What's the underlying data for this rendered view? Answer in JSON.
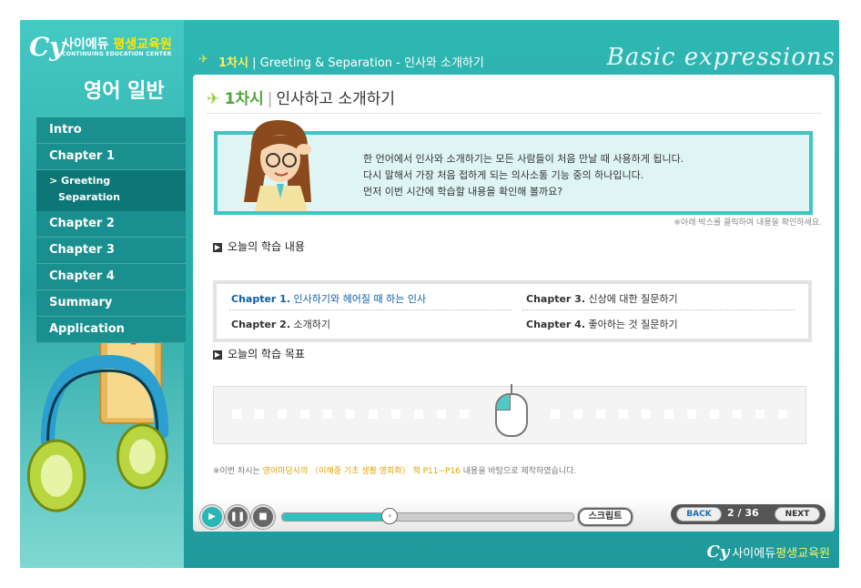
{
  "brand": {
    "logo": "Cy",
    "name_white": "사이에듀",
    "name_yellow": "평생교육원",
    "sub": "CONTINUING EDUCATION CENTER"
  },
  "course_title": "영어 일반",
  "topbar": {
    "session": "1차시",
    "breadcrumb": "Greeting & Separation - 인사와 소개하기",
    "script_title": "Basic expressions"
  },
  "nav": {
    "items": [
      "Intro",
      "Chapter 1",
      "Chapter 2",
      "Chapter 3",
      "Chapter 4",
      "Summary",
      "Application"
    ],
    "sub_items": [
      "> Greeting",
      "Separation"
    ]
  },
  "page": {
    "session": "1차시",
    "title": "인사하고 소개하기"
  },
  "speech": {
    "lines": [
      "한 언어에서 인사와 소개하기는 모든 사람들이 처음 만날 때 사용하게 됩니다.",
      "다시 말해서 가장 처음 접하게 되는 의사소통 기능 중의 하나입니다.",
      "먼저 이번 시간에 학습할 내용을 확인해 볼까요?"
    ]
  },
  "note_click": "※아래 박스를 클릭하여 내용을 확인하세요.",
  "section_contents": {
    "title": "오늘의 학습 내용"
  },
  "chapters": [
    {
      "label": "Chapter 1.",
      "text": "인사하기와 헤어질 때 하는 인사"
    },
    {
      "label": "Chapter 2.",
      "text": "소개하기"
    },
    {
      "label": "Chapter 3.",
      "text": "신상에 대한 질문하기"
    },
    {
      "label": "Chapter 4.",
      "text": "좋아하는 것 질문하기"
    }
  ],
  "section_goals": {
    "title": "오늘의 학습 목표"
  },
  "note_source": {
    "prefix": "※이번 차시는 ",
    "highlight": "영어마당사의 〈이해중 기초 생활 영회화〉 책 P11~P16",
    "suffix": " 내용을 바탕으로 제작하였습니다."
  },
  "player": {
    "script_label": "스크립트",
    "back_label": "BACK",
    "next_label": "NEXT",
    "page": "2 / 36",
    "progress": 0.37
  },
  "footer": {
    "logo": "Cy",
    "name_white": "사이에듀",
    "name_yellow": "평생교육원"
  },
  "colors": {
    "teal": "#2fb7b3",
    "accent_yellow": "#ffe600",
    "link_blue": "#0e5fa6"
  }
}
